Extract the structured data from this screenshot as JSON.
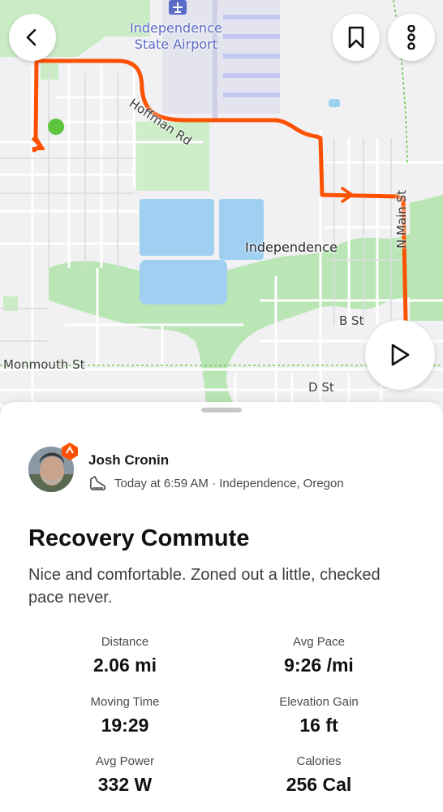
{
  "map": {
    "labels": {
      "airport_line1": "Independence",
      "airport_line2": "State Airport",
      "hoffman": "Hoffman Rd",
      "city": "Independence",
      "main_st": "N Main St",
      "b_st": "B St",
      "monmouth": "Monmouth St",
      "d_st": "D St"
    },
    "route_color": "#fc5200",
    "start_color": "#5cc63c"
  },
  "buttons": {
    "back": "back-icon",
    "bookmark": "bookmark-icon",
    "more": "more-vertical-icon",
    "play": "play-icon"
  },
  "athlete": {
    "name": "Josh Cronin",
    "activity_icon": "shoe-icon",
    "meta": "Today at 6:59 AM · Independence, Oregon"
  },
  "activity": {
    "title": "Recovery Commute",
    "description": "Nice and comfortable. Zoned out a little, checked pace never."
  },
  "stats": [
    {
      "label": "Distance",
      "value": "2.06 mi"
    },
    {
      "label": "Avg Pace",
      "value": "9:26 /mi"
    },
    {
      "label": "Moving Time",
      "value": "19:29"
    },
    {
      "label": "Elevation Gain",
      "value": "16 ft"
    },
    {
      "label": "Avg Power",
      "value": "332 W"
    },
    {
      "label": "Calories",
      "value": "256 Cal"
    }
  ]
}
